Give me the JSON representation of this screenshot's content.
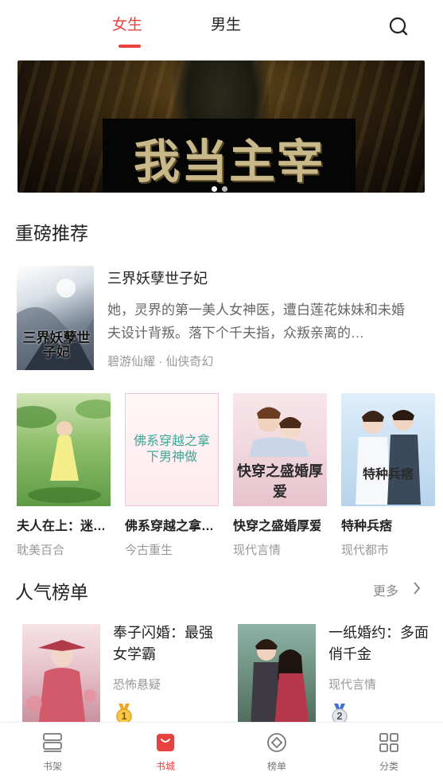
{
  "header": {
    "tabs": [
      {
        "label": "女生",
        "active": true
      },
      {
        "label": "男生",
        "active": false
      }
    ],
    "search_icon": "search-icon"
  },
  "banner": {
    "title": "我当主宰",
    "dots": 2,
    "active_dot": 1
  },
  "recommend": {
    "section_title": "重磅推荐",
    "featured": {
      "cover_text": "三界妖孽世子妃",
      "title": "三界妖孽世子妃",
      "description": "她，灵界的第一美人女神医，遭白莲花妹妹和未婚夫设计背叛。落下个千夫指，众叛亲离的…",
      "meta": "碧游仙耀 · 仙侠奇幻"
    },
    "grid": [
      {
        "title": "夫人在上：迷…",
        "category": "耽美百合",
        "cover_text": ""
      },
      {
        "title": "佛系穿越之拿…",
        "category": "今古重生",
        "cover_text": "佛系穿越之拿下男神做"
      },
      {
        "title": "快穿之盛婚厚爱",
        "category": "现代言情",
        "cover_text": "快穿之盛婚厚爱"
      },
      {
        "title": "特种兵痞",
        "category": "现代都市",
        "cover_text": "特种兵痞"
      }
    ]
  },
  "ranking": {
    "section_title": "人气榜单",
    "more_label": "更多",
    "items": [
      {
        "title": "奉子闪婚：最强女学霸",
        "category": "恐怖悬疑",
        "rank": "1"
      },
      {
        "title": "一纸婚约：多面俏千金",
        "category": "现代言情",
        "rank": "2"
      }
    ]
  },
  "bottom_nav": [
    {
      "label": "书架",
      "icon": "bookshelf-icon",
      "active": false
    },
    {
      "label": "书城",
      "icon": "bookstore-icon",
      "active": true
    },
    {
      "label": "榜单",
      "icon": "ranking-icon",
      "active": false
    },
    {
      "label": "分类",
      "icon": "category-icon",
      "active": false
    }
  ],
  "colors": {
    "accent": "#e8423f",
    "text_primary": "#222222",
    "text_secondary": "#999999"
  }
}
